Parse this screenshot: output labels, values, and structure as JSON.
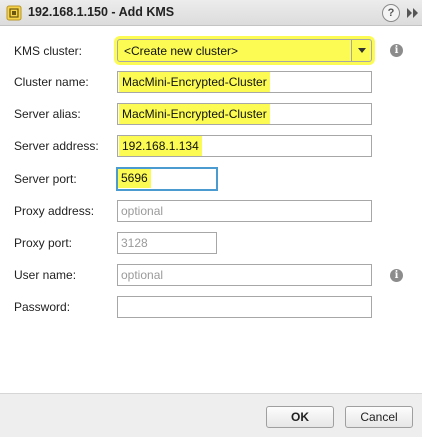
{
  "window": {
    "title": "192.168.1.150 - Add KMS",
    "help_label": "?",
    "app_icon": "vsphere-icon",
    "expand_icon": "double-chevron-right-icon"
  },
  "form": {
    "kms_cluster": {
      "label": "KMS cluster:",
      "selected": "<Create new cluster>"
    },
    "cluster_name": {
      "label": "Cluster name:",
      "value": "MacMini-Encrypted-Cluster"
    },
    "server_alias": {
      "label": "Server alias:",
      "value": "MacMini-Encrypted-Cluster"
    },
    "server_address": {
      "label": "Server address:",
      "value": "192.168.1.134"
    },
    "server_port": {
      "label": "Server port:",
      "value": "5696"
    },
    "proxy_address": {
      "label": "Proxy address:",
      "value": "",
      "placeholder": "optional"
    },
    "proxy_port": {
      "label": "Proxy port:",
      "value": "",
      "placeholder": "3128"
    },
    "user_name": {
      "label": "User name:",
      "value": "",
      "placeholder": "optional"
    },
    "password": {
      "label": "Password:",
      "value": ""
    }
  },
  "info_icon_glyph": "i",
  "footer": {
    "ok_label": "OK",
    "cancel_label": "Cancel"
  },
  "colors": {
    "highlight": "#fbfb53",
    "focus_border": "#4b9bd1"
  }
}
